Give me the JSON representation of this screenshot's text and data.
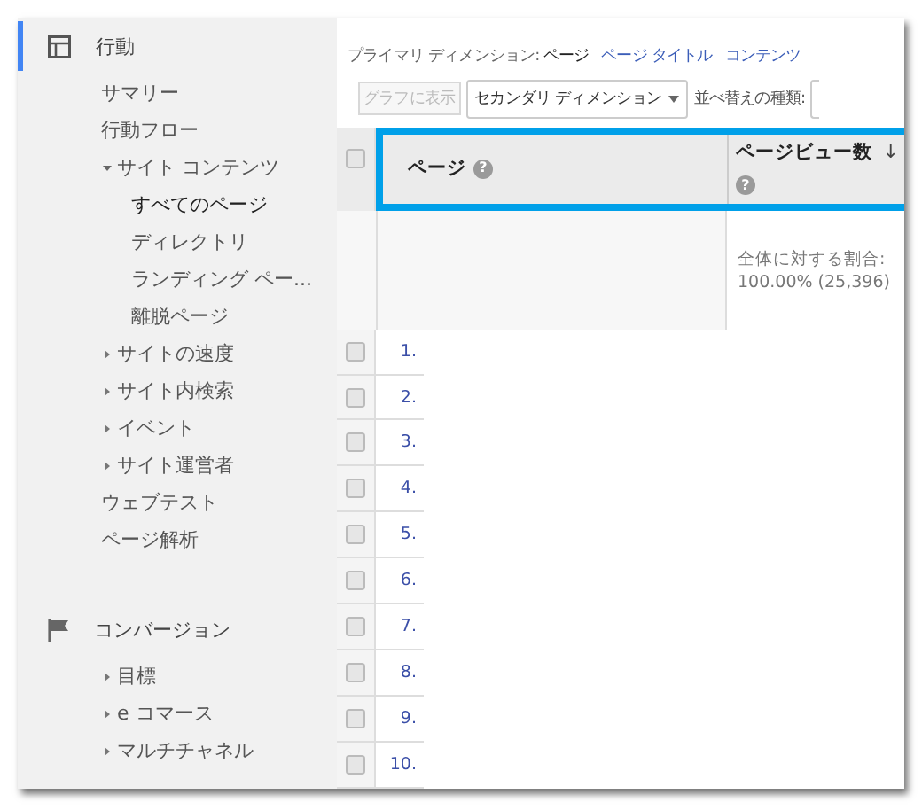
{
  "sidebar": {
    "sections": [
      {
        "label": "行動",
        "selected": true,
        "items": [
          {
            "label": "サマリー",
            "kind": "link"
          },
          {
            "label": "行動フロー",
            "kind": "link"
          },
          {
            "label": "サイト コンテンツ",
            "kind": "group",
            "expanded": true,
            "children": [
              {
                "label": "すべてのページ",
                "selected": true
              },
              {
                "label": "ディレクトリ",
                "selected": false
              },
              {
                "label": "ランディング ペー...",
                "selected": false
              },
              {
                "label": "離脱ページ",
                "selected": false
              }
            ]
          },
          {
            "label": "サイトの速度",
            "kind": "group",
            "expanded": false
          },
          {
            "label": "サイト内検索",
            "kind": "group",
            "expanded": false
          },
          {
            "label": "イベント",
            "kind": "group",
            "expanded": false
          },
          {
            "label": "サイト運営者",
            "kind": "group",
            "expanded": false
          },
          {
            "label": "ウェブテスト",
            "kind": "link"
          },
          {
            "label": "ページ解析",
            "kind": "link"
          }
        ]
      },
      {
        "label": "コンバージョン",
        "selected": false,
        "items": [
          {
            "label": "目標",
            "kind": "group",
            "expanded": false
          },
          {
            "label": "e コマース",
            "kind": "group",
            "expanded": false
          },
          {
            "label": "マルチチャネル",
            "kind": "group",
            "expanded": false
          }
        ]
      }
    ]
  },
  "primary_dimension": {
    "label": "プライマリ ディメンション:",
    "options": [
      {
        "label": "ページ",
        "selected": true
      },
      {
        "label": "ページ タイトル",
        "selected": false
      },
      {
        "label": "コンテンツ",
        "selected": false
      }
    ]
  },
  "toolbar": {
    "chart_button": {
      "label": "グラフに表示",
      "disabled": true
    },
    "secondary_dimension": "セカンダリ ディメンション",
    "sort_label": "並べ替えの種類:"
  },
  "table": {
    "header_checkbox": {
      "checked": false
    },
    "columns": [
      {
        "label": "ページ",
        "help": "?"
      },
      {
        "label": "ページビュー数",
        "help": "?",
        "sort_icon": "↓"
      }
    ],
    "totals": {
      "label": "全体に対する割合:",
      "value": "100.00% (25,396)"
    },
    "rows": [
      {
        "number": "1.",
        "checked": false
      },
      {
        "number": "2.",
        "checked": false
      },
      {
        "number": "3.",
        "checked": false
      },
      {
        "number": "4.",
        "checked": false
      },
      {
        "number": "5.",
        "checked": false
      },
      {
        "number": "6.",
        "checked": false
      },
      {
        "number": "7.",
        "checked": false
      },
      {
        "number": "8.",
        "checked": false
      },
      {
        "number": "9.",
        "checked": false
      },
      {
        "number": "10.",
        "checked": false
      }
    ]
  }
}
